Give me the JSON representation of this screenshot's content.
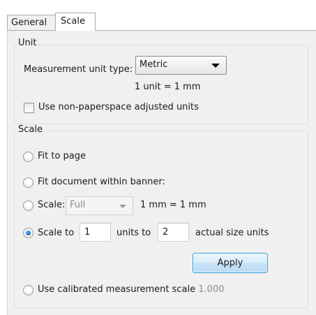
{
  "tabs": [
    {
      "label": "General"
    },
    {
      "label": "Scale"
    }
  ],
  "unit_group": {
    "title": "Unit",
    "measurement_label": "Measurement unit type:",
    "unit_type_value": "Metric",
    "conversion_text": "1 unit = 1 mm",
    "non_paperspace_label": "Use non-paperspace adjusted units"
  },
  "scale_group": {
    "title": "Scale",
    "fit_to_page_label": "Fit to page",
    "fit_banner_label": "Fit document within banner:",
    "scale_label": "Scale:",
    "scale_value": "Full",
    "scale_ratio_text": "1 mm = 1 mm",
    "scale_to_label": "Scale to",
    "scale_to_value": "1",
    "units_to_label": "units to",
    "units_to_value": "2",
    "actual_size_label": "actual size units",
    "apply_label": "Apply",
    "calibrated_label": "Use calibrated measurement scale",
    "calibrated_value": "1.000"
  }
}
